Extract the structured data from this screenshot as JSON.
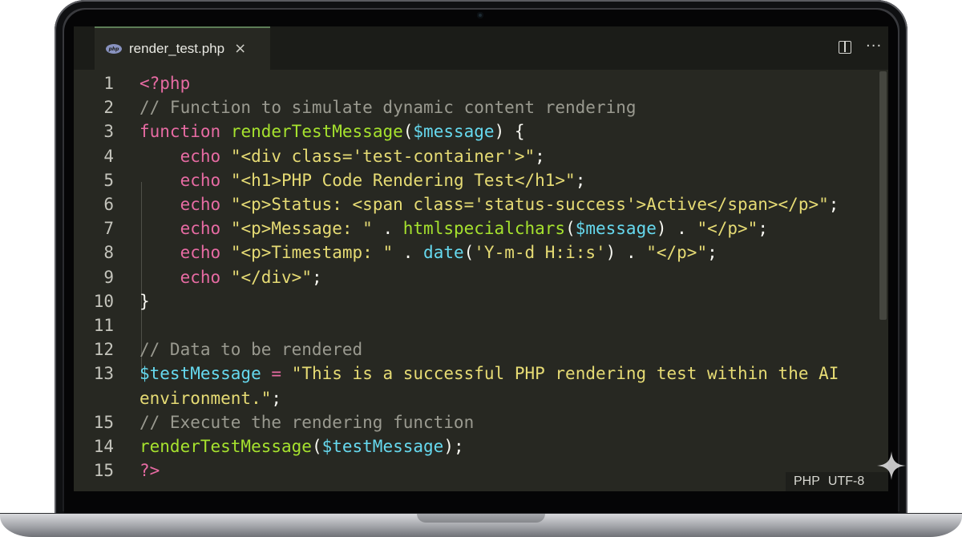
{
  "editor": {
    "tab": {
      "filename": "render_test.php",
      "file_type_icon": "php-file-icon",
      "close_glyph": "×"
    },
    "toolbar": {
      "split_icon": "split-editor-icon",
      "more_glyph": "···"
    },
    "status_bar": {
      "language": "PHP",
      "encoding": "UTF-8"
    },
    "colors": {
      "background": "#272822",
      "keyword": "#e76ba3",
      "function": "#a6e22e",
      "variable": "#66d9ef",
      "string": "#e6db74",
      "comment": "#9a9a90"
    },
    "lines": [
      {
        "num": "1",
        "tokens": [
          {
            "t": "kw",
            "v": "<?php"
          }
        ]
      },
      {
        "num": "2",
        "tokens": [
          {
            "t": "cm",
            "v": "// Function to simulate dynamic content rendering"
          }
        ]
      },
      {
        "num": "3",
        "tokens": [
          {
            "t": "kw",
            "v": "function"
          },
          {
            "t": "plain",
            "v": " "
          },
          {
            "t": "fn",
            "v": "renderTestMessage"
          },
          {
            "t": "plain",
            "v": "("
          },
          {
            "t": "var",
            "v": "$message"
          },
          {
            "t": "plain",
            "v": ") {"
          }
        ]
      },
      {
        "num": "4",
        "tokens": [
          {
            "t": "plain",
            "v": "    "
          },
          {
            "t": "kw",
            "v": "echo"
          },
          {
            "t": "plain",
            "v": " "
          },
          {
            "t": "str",
            "v": "\"<div class='test-container'>\""
          },
          {
            "t": "plain",
            "v": ";"
          }
        ]
      },
      {
        "num": "5",
        "tokens": [
          {
            "t": "plain",
            "v": "    "
          },
          {
            "t": "kw",
            "v": "echo"
          },
          {
            "t": "plain",
            "v": " "
          },
          {
            "t": "str",
            "v": "\"<h1>PHP Code Rendering Test</h1>\""
          },
          {
            "t": "plain",
            "v": ";"
          }
        ]
      },
      {
        "num": "6",
        "tokens": [
          {
            "t": "plain",
            "v": "    "
          },
          {
            "t": "kw",
            "v": "echo"
          },
          {
            "t": "plain",
            "v": " "
          },
          {
            "t": "str",
            "v": "\"<p>Status: <span class='status-success'>Active</span></p>\""
          },
          {
            "t": "plain",
            "v": ";"
          }
        ]
      },
      {
        "num": "7",
        "tokens": [
          {
            "t": "plain",
            "v": "    "
          },
          {
            "t": "kw",
            "v": "echo"
          },
          {
            "t": "plain",
            "v": " "
          },
          {
            "t": "str",
            "v": "\"<p>Message: \""
          },
          {
            "t": "plain",
            "v": " . "
          },
          {
            "t": "fn",
            "v": "htmlspecialchars"
          },
          {
            "t": "plain",
            "v": "("
          },
          {
            "t": "var",
            "v": "$message"
          },
          {
            "t": "plain",
            "v": ") . "
          },
          {
            "t": "str",
            "v": "\"</p>\""
          },
          {
            "t": "plain",
            "v": ";"
          }
        ]
      },
      {
        "num": "8",
        "tokens": [
          {
            "t": "plain",
            "v": "    "
          },
          {
            "t": "kw",
            "v": "echo"
          },
          {
            "t": "plain",
            "v": " "
          },
          {
            "t": "str",
            "v": "\"<p>Timestamp: \""
          },
          {
            "t": "plain",
            "v": " . "
          },
          {
            "t": "var",
            "v": "date"
          },
          {
            "t": "plain",
            "v": "("
          },
          {
            "t": "str",
            "v": "'Y-m-d H:i:s'"
          },
          {
            "t": "plain",
            "v": ") . "
          },
          {
            "t": "str",
            "v": "\"</p>\""
          },
          {
            "t": "plain",
            "v": ";"
          }
        ]
      },
      {
        "num": "9",
        "tokens": [
          {
            "t": "plain",
            "v": "    "
          },
          {
            "t": "kw",
            "v": "echo"
          },
          {
            "t": "plain",
            "v": " "
          },
          {
            "t": "str",
            "v": "\"</div>\""
          },
          {
            "t": "plain",
            "v": ";"
          }
        ]
      },
      {
        "num": "10",
        "tokens": [
          {
            "t": "plain",
            "v": "}"
          }
        ]
      },
      {
        "num": "11",
        "tokens": []
      },
      {
        "num": "12",
        "tokens": [
          {
            "t": "cm",
            "v": "// Data to be rendered"
          }
        ]
      },
      {
        "num": "13",
        "tokens": [
          {
            "t": "var",
            "v": "$testMessage"
          },
          {
            "t": "plain",
            "v": " "
          },
          {
            "t": "op",
            "v": "="
          },
          {
            "t": "plain",
            "v": " "
          },
          {
            "t": "str",
            "v": "\"This is a successful PHP rendering test within the AI"
          }
        ]
      },
      {
        "num": "",
        "tokens": [
          {
            "t": "str",
            "v": "environment.\""
          },
          {
            "t": "plain",
            "v": ";"
          }
        ]
      },
      {
        "num": "15",
        "tokens": [
          {
            "t": "cm",
            "v": "// Execute the rendering function"
          }
        ]
      },
      {
        "num": "14",
        "tokens": [
          {
            "t": "fn",
            "v": "renderTestMessage"
          },
          {
            "t": "plain",
            "v": "("
          },
          {
            "t": "var",
            "v": "$testMessage"
          },
          {
            "t": "plain",
            "v": ");"
          }
        ]
      },
      {
        "num": "15",
        "tokens": [
          {
            "t": "kw",
            "v": "?>"
          }
        ]
      }
    ]
  }
}
